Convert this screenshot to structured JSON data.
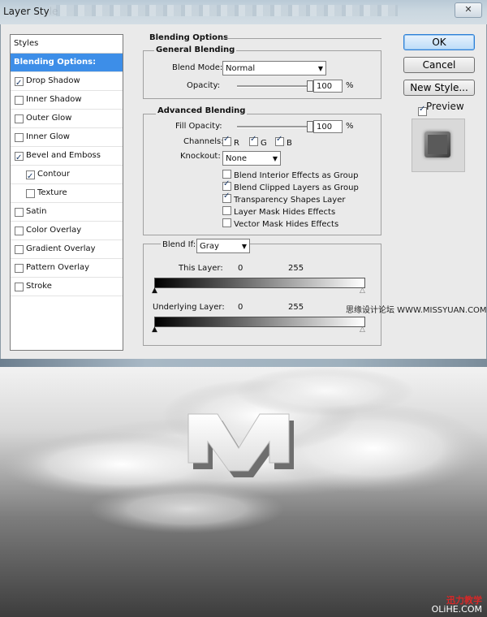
{
  "window": {
    "title": "Layer Style",
    "close_glyph": "✕"
  },
  "styles": {
    "header": "Styles",
    "items": [
      {
        "label": "Blending Options: Default",
        "checked": null,
        "active": true
      },
      {
        "label": "Drop Shadow",
        "checked": true
      },
      {
        "label": "Inner Shadow",
        "checked": false
      },
      {
        "label": "Outer Glow",
        "checked": false
      },
      {
        "label": "Inner Glow",
        "checked": false
      },
      {
        "label": "Bevel and Emboss",
        "checked": true
      },
      {
        "label": "Contour",
        "checked": true,
        "indent": true
      },
      {
        "label": "Texture",
        "checked": false,
        "indent": true
      },
      {
        "label": "Satin",
        "checked": false
      },
      {
        "label": "Color Overlay",
        "checked": false
      },
      {
        "label": "Gradient Overlay",
        "checked": false
      },
      {
        "label": "Pattern Overlay",
        "checked": false
      },
      {
        "label": "Stroke",
        "checked": false
      }
    ]
  },
  "buttons": {
    "ok": "OK",
    "cancel": "Cancel",
    "new_style": "New Style...",
    "preview_label": "Preview"
  },
  "blending": {
    "title": "Blending Options",
    "general": {
      "title": "General Blending",
      "blend_mode_label": "Blend Mode:",
      "blend_mode": "Normal",
      "opacity_label": "Opacity:",
      "opacity": "100",
      "opacity_unit": "%",
      "opacity_fraction": 1.0
    },
    "advanced": {
      "title": "Advanced Blending",
      "fill_opacity_label": "Fill Opacity:",
      "fill_opacity": "100",
      "fill_unit": "%",
      "fill_fraction": 1.0,
      "channels_label": "Channels:",
      "channel_r": "R",
      "channel_g": "G",
      "channel_b": "B",
      "knockout_label": "Knockout:",
      "knockout": "None",
      "options": [
        {
          "label": "Blend Interior Effects as Group",
          "checked": false
        },
        {
          "label": "Blend Clipped Layers as Group",
          "checked": true
        },
        {
          "label": "Transparency Shapes Layer",
          "checked": true
        },
        {
          "label": "Layer Mask Hides Effects",
          "checked": false
        },
        {
          "label": "Vector Mask Hides Effects",
          "checked": false
        }
      ]
    },
    "blend_if": {
      "label": "Blend If:",
      "value": "Gray",
      "this_layer_label": "This Layer:",
      "this_low": "0",
      "this_high": "255",
      "underlying_label": "Underlying Layer:",
      "under_low": "0",
      "under_high": "255"
    }
  },
  "watermark": "思缘设计论坛  WWW.MISSYUAN.COM",
  "artwork": {
    "letter": "M",
    "credit_top": "迅力教学",
    "credit_bottom": "OLiHE.COM"
  }
}
